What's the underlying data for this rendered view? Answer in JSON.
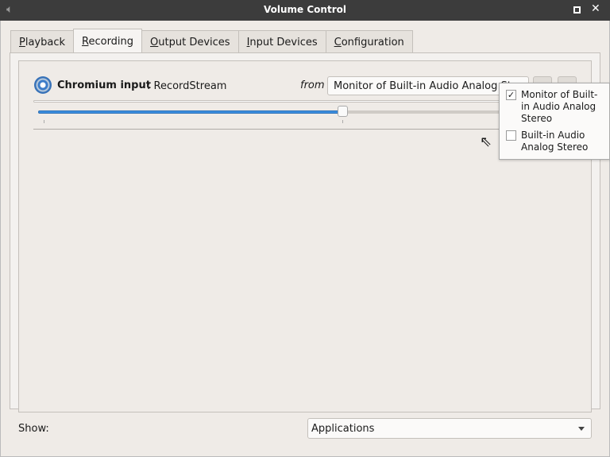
{
  "window": {
    "title": "Volume Control"
  },
  "tabs": [
    {
      "label": "Playback",
      "mnemonic": "P",
      "rest": "layback"
    },
    {
      "label": "Recording",
      "mnemonic": "R",
      "rest": "ecording",
      "active": true
    },
    {
      "label": "Output Devices",
      "mnemonic": "O",
      "rest": "utput Devices"
    },
    {
      "label": "Input Devices",
      "mnemonic": "I",
      "rest": "nput Devices"
    },
    {
      "label": "Configuration",
      "mnemonic": "C",
      "rest": "onfiguration"
    }
  ],
  "stream": {
    "app_name": "Chromium input",
    "stream_name": ": RecordStream",
    "from_label": "from",
    "source": "Monitor of Built-in Audio Analog Stereo",
    "volume_percent": 100,
    "icon": "chromium-icon"
  },
  "popup": {
    "items": [
      {
        "label": "Monitor of Built-in Audio Analog Stereo",
        "checked": true
      },
      {
        "label": "Built-in Audio Analog Stereo",
        "checked": false
      }
    ]
  },
  "footer": {
    "show_label": "Show:",
    "show_value": "Applications"
  }
}
